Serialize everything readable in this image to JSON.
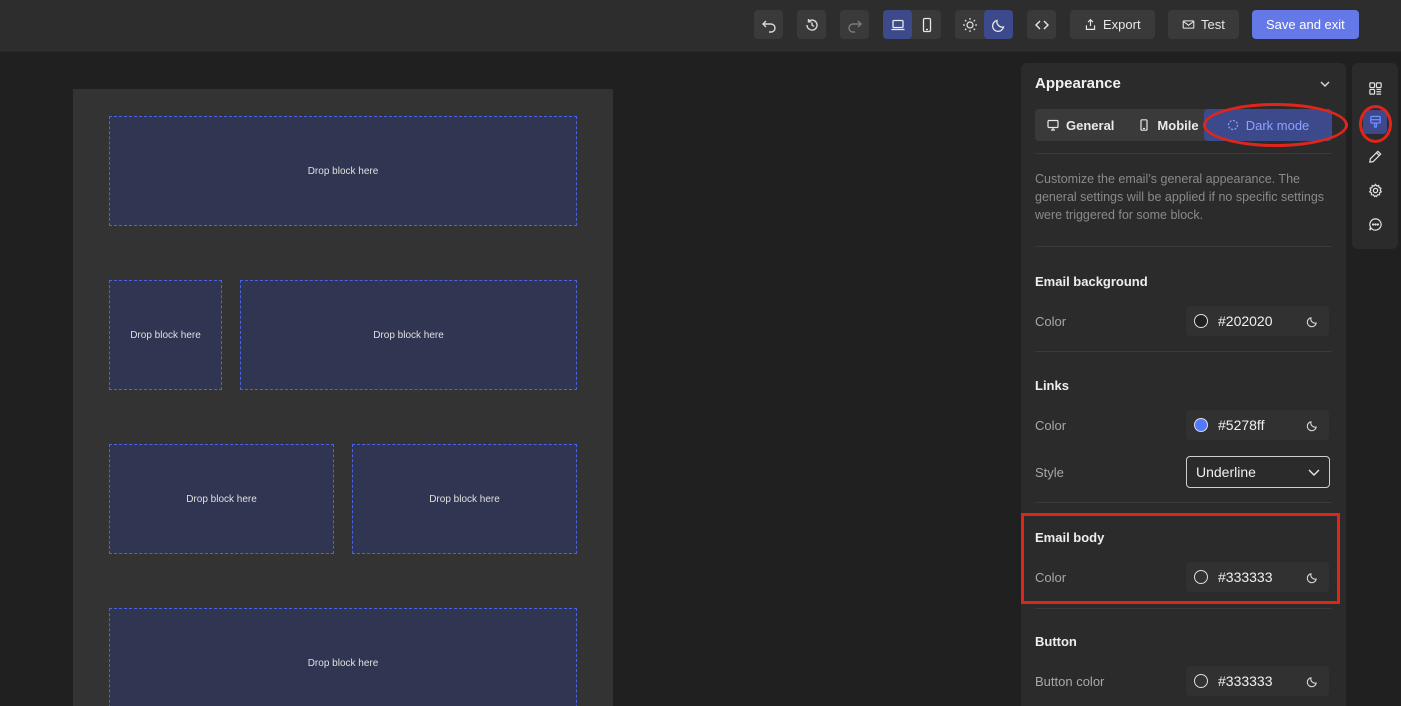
{
  "toolbar": {
    "undo_icon": "undo-icon",
    "history_icon": "history-icon",
    "redo_icon": "redo-icon",
    "desktop_icon": "laptop-icon",
    "mobile_icon": "phone-icon",
    "light_icon": "sun-icon",
    "dark_icon": "moon-icon",
    "code_icon": "code-icon",
    "export_label": "Export",
    "test_label": "Test",
    "save_label": "Save and exit"
  },
  "canvas": {
    "drop_label": "Drop block here",
    "blocks": [
      "Drop block here",
      "Drop block here",
      "Drop block here",
      "Drop block here",
      "Drop block here",
      "Drop block here"
    ]
  },
  "panel": {
    "title": "Appearance",
    "tabs": [
      {
        "label": "General",
        "icon": "monitor-icon"
      },
      {
        "label": "Mobile",
        "icon": "phone-icon"
      },
      {
        "label": "Dark mode",
        "icon": "dark-mode-icon",
        "active": true
      }
    ],
    "description": "Customize the email’s general appearance. The general settings will be applied if no specific settings were triggered for some block.",
    "sections": {
      "email_background": {
        "heading": "Email background",
        "color_label": "Color",
        "color_value": "#202020",
        "swatch": "#202020"
      },
      "links": {
        "heading": "Links",
        "color_label": "Color",
        "color_value": "#5278ff",
        "swatch": "#5278ff",
        "style_label": "Style",
        "style_value": "Underline"
      },
      "email_body": {
        "heading": "Email body",
        "color_label": "Color",
        "color_value": "#333333",
        "swatch": "#333333"
      },
      "button": {
        "heading": "Button",
        "color_label": "Button color",
        "color_value": "#333333",
        "swatch": "#333333"
      }
    }
  },
  "rail": {
    "items": [
      "blocks-icon",
      "appearance-brush-icon",
      "pen-icon",
      "settings-gear-icon",
      "chat-icon"
    ],
    "active": "appearance-brush-icon"
  },
  "colors": {
    "accent": "#6478e8",
    "active_bg": "#3c4a8c",
    "annotation": "#e0251b"
  }
}
